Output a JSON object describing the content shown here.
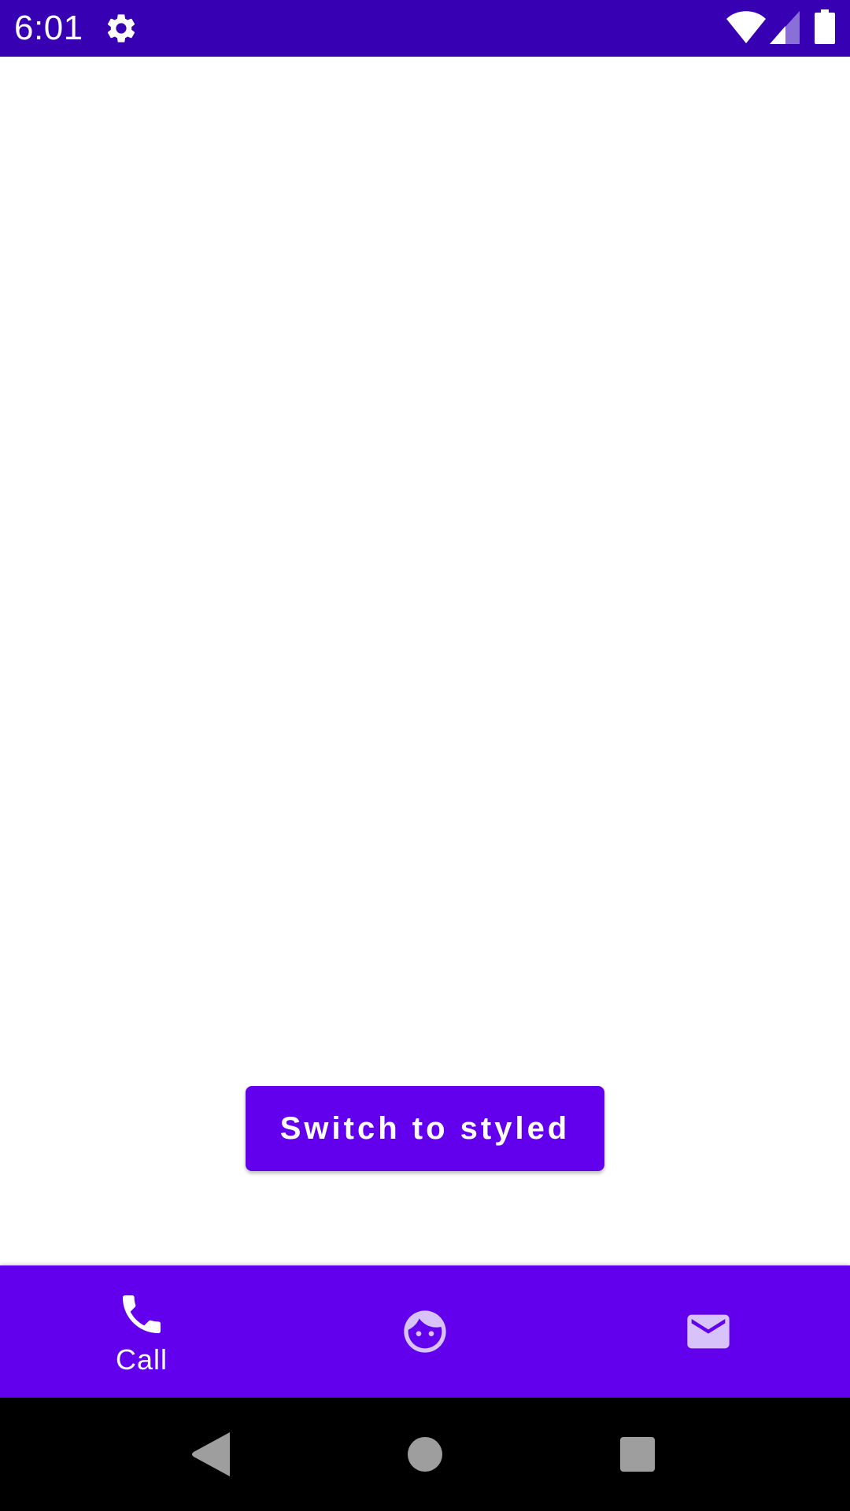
{
  "status_bar": {
    "time": "6:01",
    "icons": [
      "gear-icon",
      "wifi-icon",
      "signal-icon",
      "battery-icon"
    ],
    "background": "#3700B3"
  },
  "main": {
    "switch_button_label": "Switch to styled",
    "button_color": "#6200EE"
  },
  "bottom_nav": {
    "background": "#6200EE",
    "items": [
      {
        "label": "Call",
        "icon": "phone-icon",
        "selected": true
      },
      {
        "label": "",
        "icon": "face-icon",
        "selected": false
      },
      {
        "label": "",
        "icon": "mail-icon",
        "selected": false
      }
    ],
    "selected_color": "#FFFFFF",
    "unselected_color": "#D7C2FA"
  },
  "system_nav": {
    "icons": [
      "back-icon",
      "home-icon",
      "recents-icon"
    ],
    "background": "#000000"
  }
}
